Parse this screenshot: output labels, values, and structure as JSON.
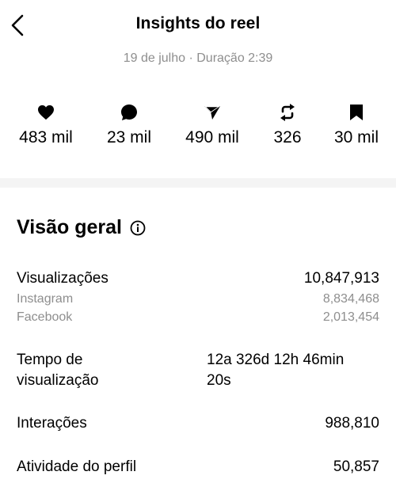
{
  "header": {
    "title": "Insights do reel",
    "back_icon": "chevron-left-icon"
  },
  "meta": {
    "date": "19 de julho",
    "separator": "·",
    "duration": "Duração 2:39"
  },
  "stats": [
    {
      "icon": "heart-icon",
      "value": "483 mil"
    },
    {
      "icon": "comment-icon",
      "value": "23 mil"
    },
    {
      "icon": "share-icon",
      "value": "490 mil"
    },
    {
      "icon": "repost-icon",
      "value": "326"
    },
    {
      "icon": "bookmark-icon",
      "value": "30 mil"
    }
  ],
  "overview": {
    "title": "Visão geral",
    "info_icon": "info-icon",
    "views": {
      "label": "Visualizações",
      "value": "10,847,913"
    },
    "instagram": {
      "label": "Instagram",
      "value": "8,834,468"
    },
    "facebook": {
      "label": "Facebook",
      "value": "2,013,454"
    },
    "watch_time": {
      "label_line1": "Tempo de",
      "label_line2": "visualização",
      "value_line1": "12a 326d 12h 46min",
      "value_line2": "20s"
    },
    "interactions": {
      "label": "Interações",
      "value": "988,810"
    },
    "profile_activity": {
      "label": "Atividade do perfil",
      "value": "50,857"
    }
  }
}
